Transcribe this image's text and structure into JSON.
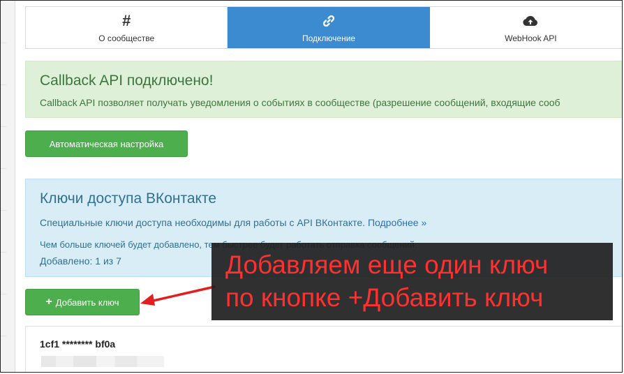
{
  "tabs": [
    {
      "label": "О сообществе",
      "icon": "hash-icon",
      "active": false
    },
    {
      "label": "Подключение",
      "icon": "link-icon",
      "active": true
    },
    {
      "label": "WebHook API",
      "icon": "cloud-upload-icon",
      "active": false
    }
  ],
  "callback": {
    "title": "Callback API подключено!",
    "text": "Callback API позволяет получать уведомления о событиях в сообществе (разрешение сообщений, входящие сооб"
  },
  "auto_setup_button": "Автоматическая настройка",
  "keys_info": {
    "title": "Ключи доступа ВКонтакте",
    "text": "Специальные ключи доступа необходимы для работы с API ВКонтакте.",
    "link": "Подробнее »",
    "note": "Чем больше ключей будет добавлено, тем быстрее будет работать отправка сообщений.",
    "added": "Добавлено: 1 из 7"
  },
  "add_key_button": {
    "plus": "+",
    "label": "Добавить ключ"
  },
  "key_item": {
    "name": "1cf1 ******** bf0a"
  },
  "annotation": {
    "line1": "Добавляем еще один ключ",
    "line2": "по кнопке +Добавить ключ"
  },
  "colors": {
    "active_tab": "#3c8ad0",
    "success_bg": "#dff0d8",
    "info_bg": "#d9edf7",
    "button_green": "#4cae4c",
    "annotation_text": "#ff3030",
    "arrow": "#e02020"
  }
}
